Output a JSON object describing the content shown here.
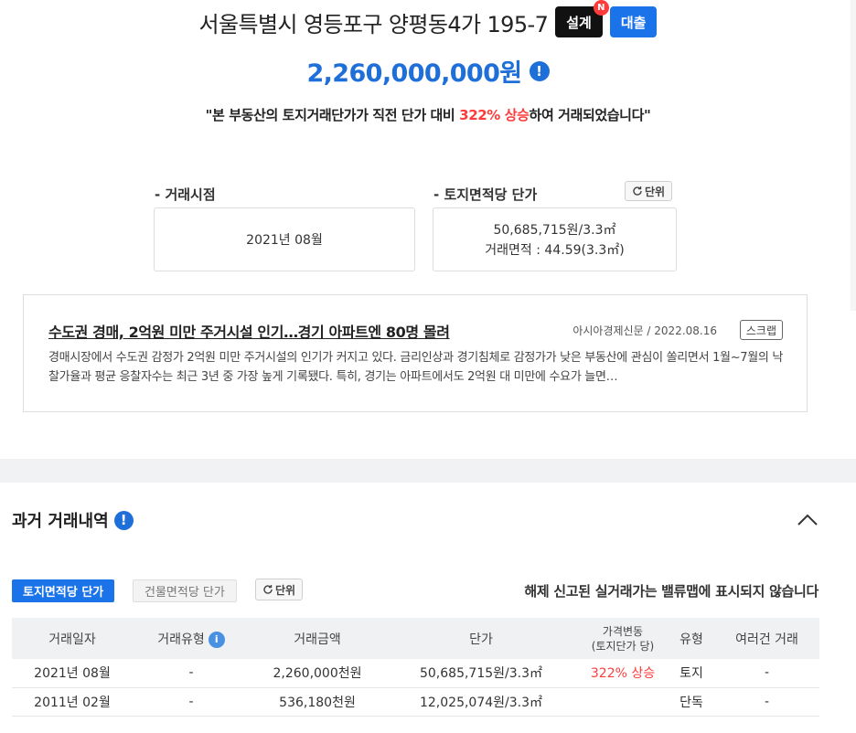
{
  "header": {
    "address": "서울특별시 영등포구 양평동4가 195-7",
    "design_badge": "설계",
    "new_badge": "N",
    "loan_badge": "대출",
    "price": "2,260,000,000원",
    "info_glyph": "!",
    "quote_prefix": "\"본 부동산의 토지거래단가가 직전 단가 대비 ",
    "quote_highlight": "322% 상승",
    "quote_suffix": "하여 거래되었습니다\""
  },
  "summary": {
    "deal_time_label": "- 거래시점",
    "deal_time_value": "2021년 08월",
    "land_unit_price_label": "- 토지면적당 단가",
    "unit_button": "단위",
    "unit_price_value": "50,685,715원/3.3㎡",
    "deal_area_value": "거래면적 : 44.59(3.3㎡)"
  },
  "news": {
    "title": "수도권 경매, 2억원 미만 주거시설 인기…경기 아파트엔 80명 몰려",
    "source": "아시아경제신문  /  2022.08.16",
    "scrap": "스크랩",
    "body": "경매시장에서 수도권 감정가 2억원 미만 주거시설의 인기가 커지고 있다. 금리인상과 경기침체로 감정가가 낮은 부동산에 관심이 쏠리면서 1월~7월의 낙찰가율과 평균 응찰자수는 최근 3년 중 가장 높게 기록됐다. 특히, 경기는 아파트에서도 2억원 대 미만에 수요가 늘면…"
  },
  "history": {
    "title": "과거 거래내역",
    "tabs": [
      "토지면적당 단가",
      "건물면적당 단가"
    ],
    "unit_button": "단위",
    "note": "해제 신고된 실거래가는 밸류맵에 표시되지 않습니다",
    "columns": {
      "date": "거래일자",
      "type": "거래유형",
      "amount": "거래금액",
      "unit_price": "단가",
      "change_1": "가격변동",
      "change_2": "(토지단가 당)",
      "kind": "유형",
      "multi": "여러건 거래"
    },
    "info_small": "i",
    "rows": [
      {
        "date": "2021년 08월",
        "type": "-",
        "amount": "2,260,000천원",
        "unit_price": "50,685,715원/3.3㎡",
        "change": "322% 상승",
        "kind": "토지",
        "multi": "-"
      },
      {
        "date": "2011년 02월",
        "type": "-",
        "amount": "536,180천원",
        "unit_price": "12,025,074원/3.3㎡",
        "change": "",
        "kind": "단독",
        "multi": "-"
      }
    ]
  },
  "colors": {
    "accent_blue": "#1a73e8",
    "price_blue": "#1f6fd8",
    "rise_red": "#ff3b3b",
    "design_black": "#111111"
  },
  "icons": [
    "info-icon",
    "refresh-icon",
    "chevron-up-icon"
  ]
}
